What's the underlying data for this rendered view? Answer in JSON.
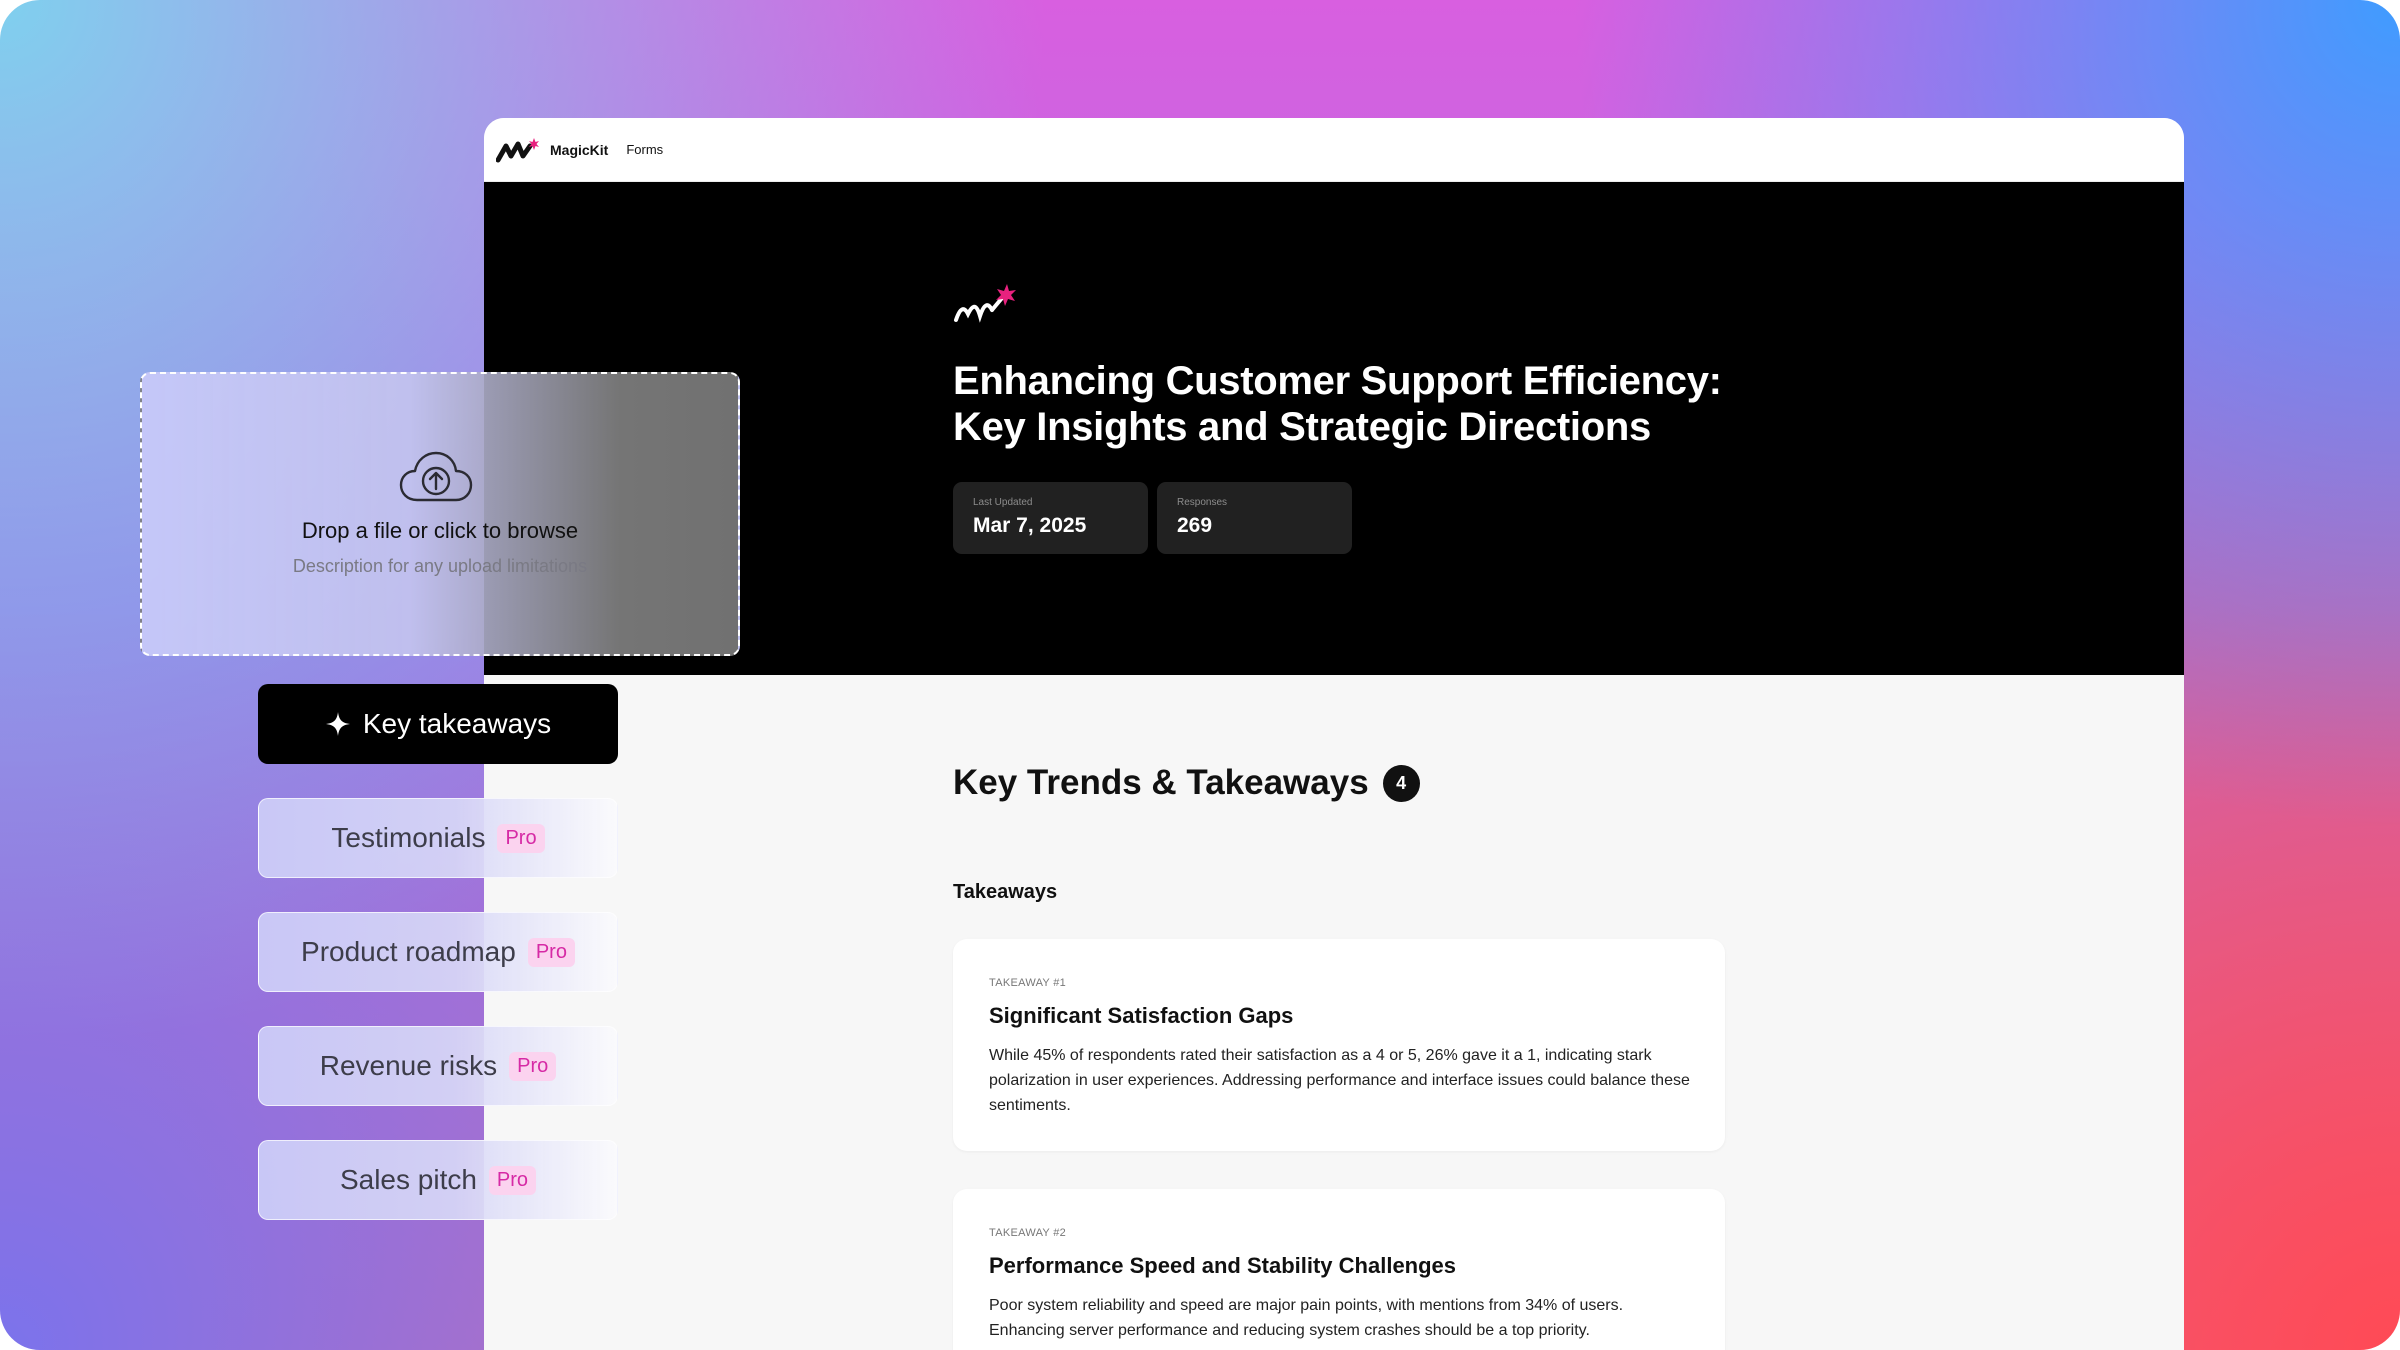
{
  "app": {
    "brand": "MagicKit",
    "nav_forms": "Forms"
  },
  "hero": {
    "title_line1": "Enhancing Customer Support Efficiency:",
    "title_line2": "Key Insights and Strategic Directions",
    "stats": [
      {
        "label": "Last Updated",
        "value": "Mar 7, 2025"
      },
      {
        "label": "Responses",
        "value": "269"
      }
    ]
  },
  "main": {
    "section_title": "Key Trends & Takeaways",
    "count": "4",
    "subheading": "Takeaways",
    "takeaways": [
      {
        "tag": "TAKEAWAY #1",
        "title": "Significant Satisfaction Gaps",
        "body": "While 45% of respondents rated their satisfaction as a 4 or 5, 26% gave it a 1, indicating stark polarization in user experiences. Addressing performance and interface issues could balance these sentiments."
      },
      {
        "tag": "TAKEAWAY #2",
        "title": "Performance Speed and Stability Challenges",
        "body": "Poor system reliability and speed are major pain points, with mentions from 34% of users. Enhancing server performance and reducing system crashes should be a top priority."
      }
    ]
  },
  "upload": {
    "text": "Drop a file or click to browse",
    "description": "Description for any upload limitations",
    "icon": "cloud-upload-icon"
  },
  "side_menu": {
    "items": [
      {
        "label": "Key takeaways",
        "icon": "sparkle-icon",
        "active": true
      },
      {
        "label": "Testimonials",
        "badge": "Pro"
      },
      {
        "label": "Product roadmap",
        "badge": "Pro"
      },
      {
        "label": "Revenue risks",
        "badge": "Pro"
      },
      {
        "label": "Sales pitch",
        "badge": "Pro"
      }
    ]
  },
  "colors": {
    "accent_pink": "#e8217e",
    "pro_badge_bg": "#fbd3ef",
    "pro_badge_text": "#d62aa5"
  }
}
